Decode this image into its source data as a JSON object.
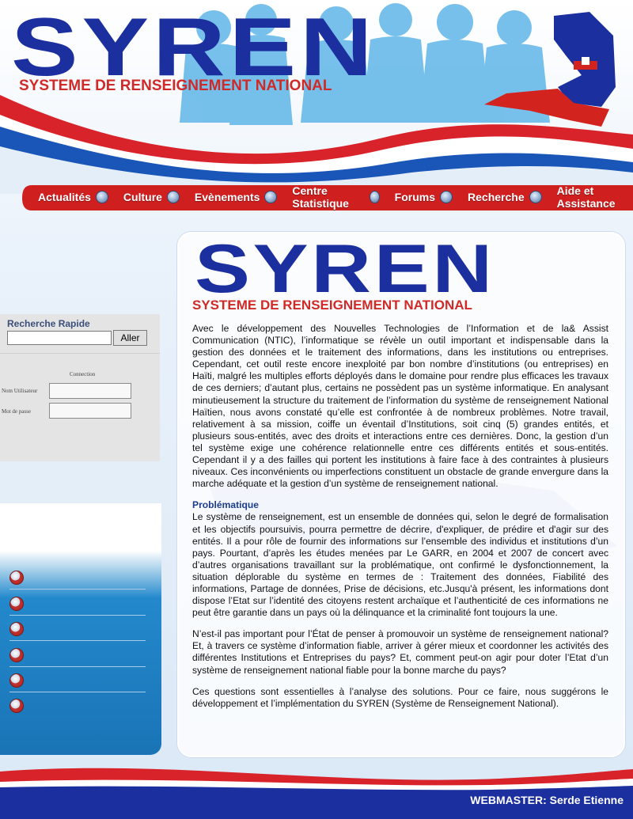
{
  "header": {
    "logo": "SYREN",
    "tagline": "SYSTEME DE RENSEIGNEMENT NATIONAL"
  },
  "nav": {
    "items": [
      {
        "label": "Actualités"
      },
      {
        "label": "Culture"
      },
      {
        "label": "Evènements"
      },
      {
        "label": "Centre Statistique"
      },
      {
        "label": "Forums"
      },
      {
        "label": "Recherche"
      },
      {
        "label": "Aide et Assistance"
      }
    ]
  },
  "quick_search": {
    "title": "Recherche Rapide",
    "input_value": "",
    "button_label": "Aller"
  },
  "connection": {
    "title": "Connection",
    "username_label": "Nom Utilisateur",
    "password_label": "Mot de passe"
  },
  "main": {
    "logo": "SYREN",
    "tagline": "SYSTEME DE RENSEIGNEMENT NATIONAL",
    "intro": "Avec le développement des Nouvelles Technologies de l’Information et de la& Assist Communication (NTIC), l’informatique se révèle un outil important et indispensable dans la gestion des données et le traitement des informations, dans les institutions ou entreprises. Cependant, cet outil reste encore inexploité par bon nombre d’institutions (ou entreprises) en Haïti, malgré les multiples efforts déployés dans le domaine pour rendre plus efficaces les travaux de ces derniers; d’autant plus, certains ne possèdent pas un système informatique. En analysant minutieusement la structure du traitement de l’information du système de renseignement National Haïtien, nous avons constaté qu’elle est confrontée à de nombreux problèmes. Notre travail, relativement à sa mission, coiffe un éventail d’Institutions, soit cinq (5) grandes entités, et plusieurs sous-entités, avec des droits et interactions entre ces dernières.  Donc, la gestion d’un tel système exige une cohérence relationnelle entre ces différents entités et sous-entités. Cependant il y a des failles qui portent les institutions à faire face à des contraintes à plusieurs niveaux. Ces inconvénients ou imperfections constituent un obstacle de grande envergure dans la marche adéquate et la gestion d’un système de renseignement national.",
    "section_title": "Problématique",
    "section_text": "Le système de renseignement, est un ensemble de données qui, selon le degré de formalisation et les objectifs poursuivis, pourra permettre de décrire, d'expliquer, de prédire et d'agir sur des entités. Il a pour rôle de fournir des informations sur l’ensemble des individus et institutions d’un pays. Pourtant, d’après les études menées par Le GARR, en 2004 et 2007 de concert avec d’autres organisations travaillant sur la problématique, ont confirmé le dysfonctionnement, la situation déplorable du système en termes de : Traitement des données, Fiabilité des informations, Partage de données, Prise de décisions, etc.Jusqu'à présent, les informations dont dispose l’Etat sur l’identité des citoyens restent archaïque et l’authenticité de ces informations ne peut être garantie dans un pays où la délinquance et la criminalité font toujours la une.",
    "question_text": "N’est-il pas important pour l’État de penser à promouvoir un système de renseignement national?  Et, à travers ce système d’information fiable, arriver à gérer mieux et coordonner les activités des différentes Institutions et Entreprises du pays? Et, comment peut-on  agir pour doter l’Etat d’un système de renseignement national fiable pour la bonne marche du pays?",
    "closing_text": "Ces questions sont essentielles à l’analyse des solutions. Pour ce faire, nous suggérons le développement et l’implémentation du SYREN (Système de Renseignement National)."
  },
  "footer": {
    "webmaster": "WEBMASTER: Serde Etienne"
  },
  "colors": {
    "brand_blue": "#1b2f9f",
    "brand_red": "#cf2a27",
    "sky": "#e3eef9"
  }
}
